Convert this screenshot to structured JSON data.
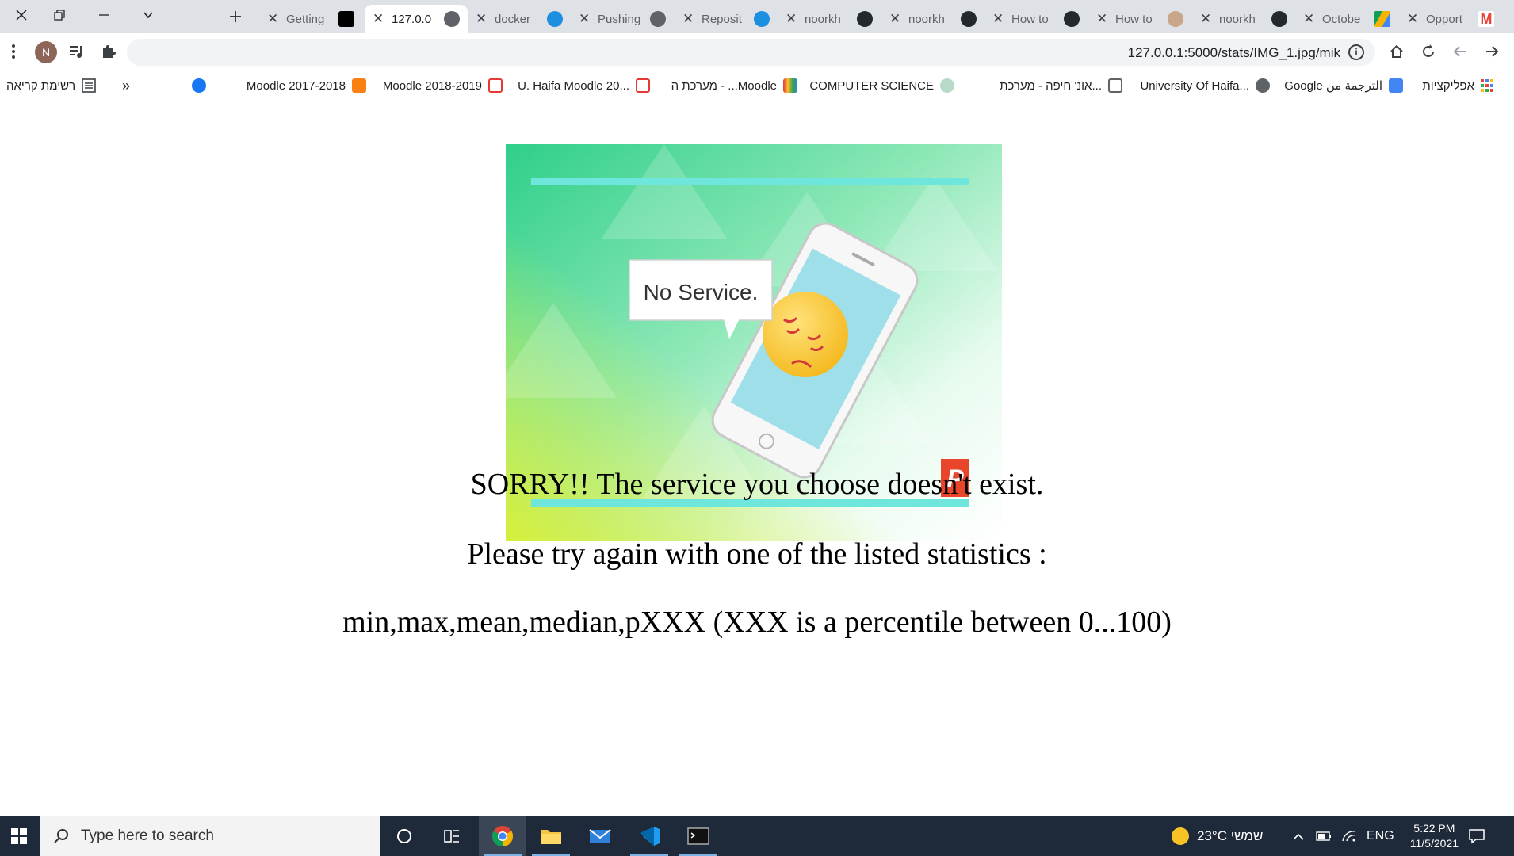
{
  "tabs": [
    {
      "title": "Getting",
      "favicon": "medium-icon",
      "active": false
    },
    {
      "title": "127.0.0",
      "favicon": "globe-icon",
      "active": true
    },
    {
      "title": "docker",
      "favicon": "docker-icon",
      "active": false
    },
    {
      "title": "Pushing",
      "favicon": "globe-icon",
      "active": false
    },
    {
      "title": "Reposit",
      "favicon": "docker-icon",
      "active": false
    },
    {
      "title": "noorkh",
      "favicon": "github-icon",
      "active": false
    },
    {
      "title": "noorkh",
      "favicon": "github-icon",
      "active": false
    },
    {
      "title": "How to",
      "favicon": "github-alt-icon",
      "active": false
    },
    {
      "title": "How to",
      "favicon": "avatar-icon",
      "active": false
    },
    {
      "title": "noorkh",
      "favicon": "github-icon",
      "active": false
    },
    {
      "title": "Octobe",
      "favicon": "google-drive-icon",
      "active": false
    },
    {
      "title": "Opport",
      "favicon": "gmail-icon",
      "active": false
    }
  ],
  "toolbar": {
    "profile_initial": "N",
    "url": "127.0.0.1:5000/stats/IMG_1.jpg/mik"
  },
  "bookmarks": {
    "apps": "אפליקציות",
    "items": [
      "Google الترجمة من",
      "University Of Haifa...",
      "אונ' חיפה - מערכת...",
      "COMPUTER SCIENCE",
      "מערכת ה - ...Moodle",
      "U. Haifa Moodle 20...",
      "Moodle 2018-2019",
      "Moodle 2017-2018"
    ],
    "overflow": "»",
    "reading_list": "רשימת קריאה"
  },
  "image": {
    "bubble_text": "No Service."
  },
  "messages": {
    "line1": "SORRY!! The service you choose doesn't exist.",
    "line2": "Please try again with one of the listed statistics :",
    "line3": "min,max,mean,median,pXXX (XXX is a percentile between 0...100)"
  },
  "taskbar": {
    "search_placeholder": "Type here to search",
    "weather": "23°C שמשי",
    "language": "ENG",
    "time": "5:22 PM",
    "date": "11/5/2021"
  }
}
